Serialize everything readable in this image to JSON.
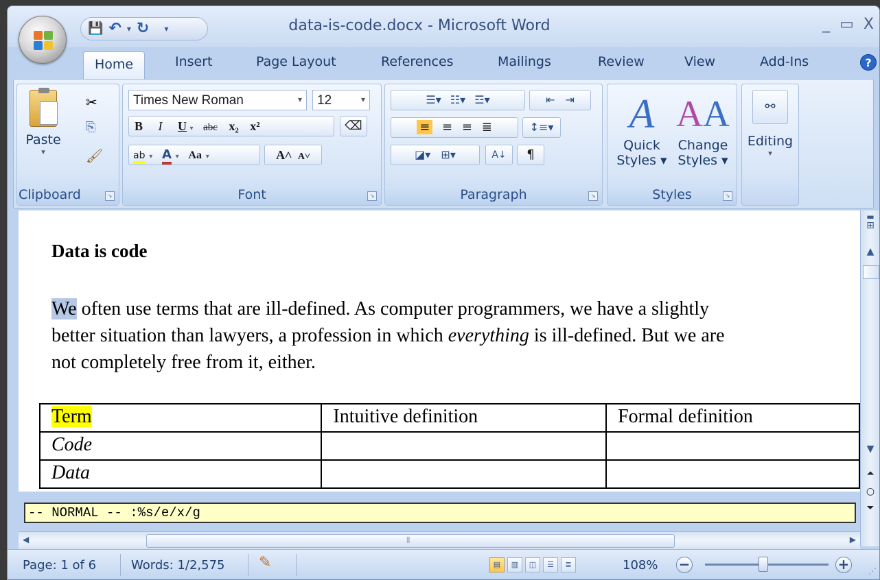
{
  "window": {
    "title": "data-is-code.docx - Microsoft Word",
    "minimize": "_",
    "maximize": "▭",
    "close": "X"
  },
  "qat": {
    "save": "💾",
    "undo": "↶",
    "redo": "↻",
    "more": "▾"
  },
  "tabs": [
    "Home",
    "Insert",
    "Page Layout",
    "References",
    "Mailings",
    "Review",
    "View",
    "Add-Ins"
  ],
  "ribbon": {
    "clipboard": {
      "label": "Clipboard",
      "paste": "Paste"
    },
    "font": {
      "label": "Font",
      "name": "Times New Roman",
      "size": "12",
      "bold": "B",
      "italic": "I",
      "underline": "U",
      "strike": "abc",
      "sub": "x₂",
      "sup": "x²",
      "highlight": "ab",
      "fontcolor": "A",
      "changecase": "Aa",
      "grow": "A˄",
      "shrink": "A˅"
    },
    "paragraph": {
      "label": "Paragraph",
      "pilcrow": "¶"
    },
    "styles": {
      "label": "Styles",
      "quick": [
        "Quick",
        "Styles ▾"
      ],
      "change": [
        "Change",
        "Styles ▾"
      ]
    },
    "editing": {
      "label": "Editing"
    }
  },
  "document": {
    "heading": "Data is code",
    "para_lines": [
      {
        "sel": "We",
        "rest": " often use terms that are ill-defined. As computer programmers, we have a slightly"
      },
      {
        "a": "better situation than lawyers, a profession in which ",
        "em": "everything",
        "b": " is ill-defined. But we are"
      },
      {
        "a": "not completely free from it, either."
      }
    ],
    "table": {
      "headers": [
        "Term",
        "Intuitive definition",
        "Formal definition"
      ],
      "rows": [
        [
          "Code",
          "",
          ""
        ],
        [
          "Data",
          "",
          ""
        ]
      ]
    }
  },
  "vim_status": "-- NORMAL -- :%s/e/x/g",
  "status": {
    "page": "Page: 1 of 6",
    "words": "Words: 1/2,575",
    "zoom": "108%",
    "zoom_level": 108
  },
  "colors": {
    "ribbon": "#cedff4",
    "highlight": "#ffff00",
    "vim_bg": "#ffffc8"
  }
}
